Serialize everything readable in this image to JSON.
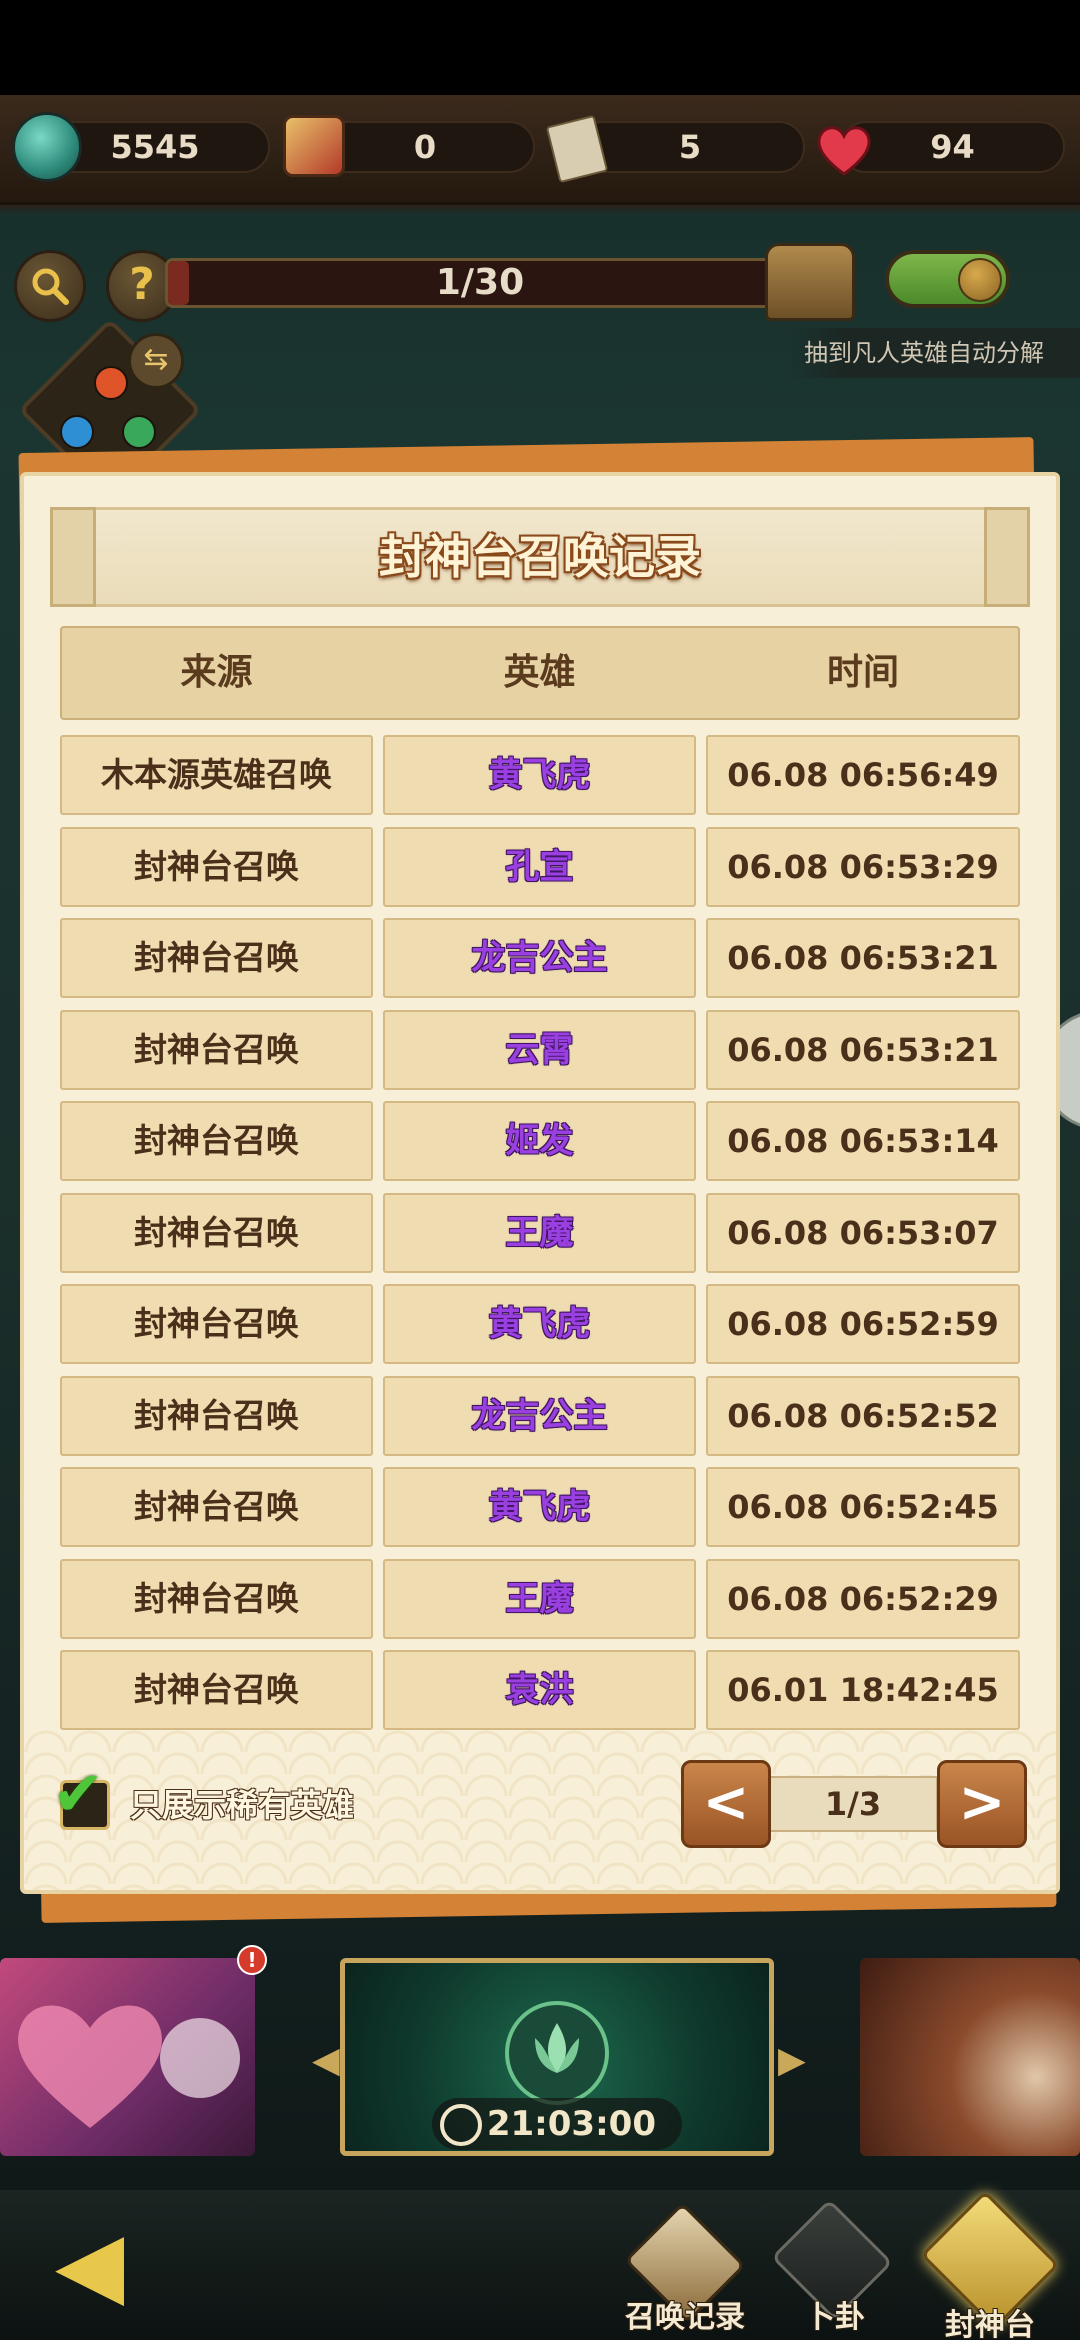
{
  "resources": {
    "jade": "5545",
    "hero_token": "0",
    "ticket": "5",
    "heart": "94"
  },
  "toolbar": {
    "search_icon": "search-icon",
    "help_label": "?",
    "progress_text": "1/30",
    "progress_value": 0.0333,
    "auto_decompose_label": "抽到凡人英雄自动分解"
  },
  "dialog": {
    "title": "封神台召唤记录",
    "headers": [
      "来源",
      "英雄",
      "时间"
    ],
    "rows": [
      {
        "source": "木本源英雄召唤",
        "hero": "黄飞虎",
        "time": "06.08 06:56:49"
      },
      {
        "source": "封神台召唤",
        "hero": "孔宣",
        "time": "06.08 06:53:29"
      },
      {
        "source": "封神台召唤",
        "hero": "龙吉公主",
        "time": "06.08 06:53:21"
      },
      {
        "source": "封神台召唤",
        "hero": "云霄",
        "time": "06.08 06:53:21"
      },
      {
        "source": "封神台召唤",
        "hero": "姬发",
        "time": "06.08 06:53:14"
      },
      {
        "source": "封神台召唤",
        "hero": "王魔",
        "time": "06.08 06:53:07"
      },
      {
        "source": "封神台召唤",
        "hero": "黄飞虎",
        "time": "06.08 06:52:59"
      },
      {
        "source": "封神台召唤",
        "hero": "龙吉公主",
        "time": "06.08 06:52:52"
      },
      {
        "source": "封神台召唤",
        "hero": "黄飞虎",
        "time": "06.08 06:52:45"
      },
      {
        "source": "封神台召唤",
        "hero": "王魔",
        "time": "06.08 06:52:29"
      },
      {
        "source": "封神台召唤",
        "hero": "袁洪",
        "time": "06.01 18:42:45"
      }
    ],
    "filter_label": "只展示稀有英雄",
    "filter_checked": true,
    "prev_label": "<",
    "next_label": ">",
    "page_indicator": "1/3"
  },
  "banner": {
    "timer": "21:03:00",
    "badge": "!"
  },
  "nav": {
    "summon_record": "召唤记录",
    "divination": "卜卦",
    "fengshen_tai": "封神台"
  },
  "colors": {
    "hero_name": "#9a3fe0",
    "panel_bg": "#f8efd8",
    "accent_orange": "#d48235"
  }
}
